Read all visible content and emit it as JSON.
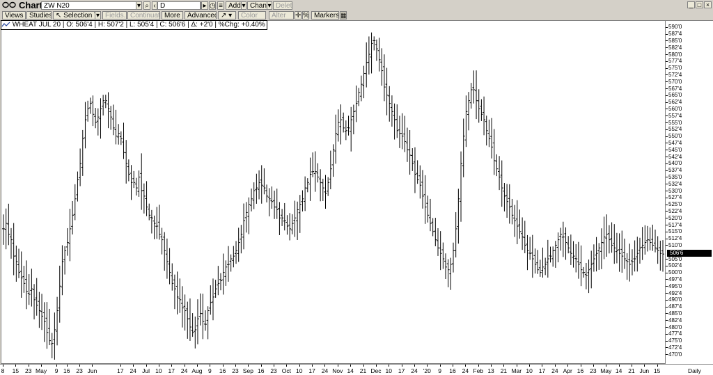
{
  "window": {
    "title": "Chart"
  },
  "header": {
    "symbol": "ZW N20",
    "interval": "D",
    "add_label": "Add",
    "change_label": "Change",
    "delete_label": "Delete"
  },
  "toolbar": {
    "views": "Views",
    "studies": "Studies...",
    "selection_tool": "Selection Tool",
    "fields": "Fields...",
    "continuation": "Continuation",
    "more": "More",
    "advanced": "Advanced",
    "color": "Color",
    "alter": "Alter",
    "percent": "%",
    "markers": "Markers"
  },
  "legend": {
    "name": "WHEAT JUL 20",
    "open": "O: 506'4",
    "high": "H: 507'2",
    "low": "L: 505'4",
    "close": "C: 506'6",
    "change": "Δ: +2'0",
    "pct_change": "%Chg: +0.40%"
  },
  "chart_data": {
    "type": "ohlc",
    "series_name": "WHEAT JUL 20",
    "last_price": "506'6",
    "last_value": 506.75,
    "y_range": [
      467,
      592
    ],
    "y_tick_labels": [
      "590'0",
      "587'4",
      "585'0",
      "582'4",
      "580'0",
      "577'4",
      "575'0",
      "572'4",
      "570'0",
      "567'4",
      "565'0",
      "562'4",
      "560'0",
      "557'4",
      "555'0",
      "552'4",
      "550'0",
      "547'4",
      "545'0",
      "542'4",
      "540'0",
      "537'4",
      "535'0",
      "532'4",
      "530'0",
      "527'4",
      "525'0",
      "522'4",
      "520'0",
      "517'4",
      "515'0",
      "512'4",
      "510'0",
      "505'0",
      "502'4",
      "500'0",
      "497'4",
      "495'0",
      "492'4",
      "490'0",
      "487'4",
      "485'0",
      "482'4",
      "480'0",
      "477'4",
      "475'0",
      "472'4",
      "470'0"
    ],
    "y_tick_values": [
      590,
      587.5,
      585,
      582.5,
      580,
      577.5,
      575,
      572.5,
      570,
      567.5,
      565,
      562.5,
      560,
      557.5,
      555,
      552.5,
      550,
      547.5,
      545,
      542.5,
      540,
      537.5,
      535,
      532.5,
      530,
      527.5,
      525,
      522.5,
      520,
      517.5,
      515,
      512.5,
      510,
      505,
      502.5,
      500,
      497.5,
      495,
      492.5,
      490,
      487.5,
      485,
      482.5,
      480,
      477.5,
      475,
      472.5,
      470
    ],
    "x_tick_labels": [
      "8",
      "15",
      "23",
      "May",
      "9",
      "16",
      "23",
      "Jun",
      "17",
      "24",
      "Jul",
      "10",
      "17",
      "24",
      "Aug",
      "9",
      "16",
      "23",
      "Sep",
      "16",
      "23",
      "Oct",
      "10",
      "17",
      "24",
      "Nov",
      "14",
      "21",
      "Dec",
      "10",
      "17",
      "24",
      "'20",
      "9",
      "16",
      "24",
      "Feb",
      "13",
      "21",
      "Mar",
      "10",
      "17",
      "24",
      "Apr",
      "16",
      "23",
      "May",
      "14",
      "21",
      "Jun",
      "15"
    ],
    "x_tick_index": [
      0,
      5,
      10,
      15,
      21,
      25,
      30,
      35,
      46,
      51,
      56,
      61,
      66,
      71,
      76,
      81,
      86,
      91,
      96,
      101,
      106,
      111,
      116,
      121,
      126,
      131,
      136,
      141,
      146,
      151,
      156,
      161,
      166,
      171,
      176,
      181,
      186,
      191,
      196,
      201,
      206,
      211,
      216,
      221,
      226,
      231,
      236,
      241,
      246,
      251,
      256
    ],
    "x_axis_period": "Daily",
    "closes": [
      516,
      518,
      514,
      512,
      506,
      504,
      500,
      498,
      496,
      493,
      492,
      494,
      490,
      488,
      486,
      484,
      482,
      478,
      475,
      474,
      479,
      486,
      495,
      504,
      508,
      511,
      516,
      521,
      527,
      534,
      540,
      549,
      556,
      560,
      562,
      558,
      555,
      557,
      560,
      563,
      563,
      560,
      557,
      553,
      550,
      551,
      549,
      544,
      540,
      536,
      533,
      533,
      531,
      535,
      530,
      528,
      524,
      521,
      520,
      518,
      517,
      514,
      512,
      508,
      504,
      500,
      496,
      494,
      491,
      490,
      487,
      486,
      483,
      480,
      478,
      479,
      483,
      485,
      482,
      481,
      486,
      489,
      491,
      494,
      496,
      497,
      500,
      502,
      503,
      505,
      506,
      508,
      511,
      514,
      519,
      522,
      525,
      527,
      530,
      531,
      533,
      532,
      531,
      528,
      527,
      526,
      524,
      523,
      520,
      520,
      519,
      517,
      516,
      518,
      520,
      523,
      525,
      527,
      531,
      533,
      536,
      537,
      537,
      535,
      533,
      531,
      529,
      533,
      538,
      545,
      551,
      555,
      556,
      553,
      552,
      553,
      556,
      559,
      562,
      566,
      569,
      573,
      577,
      580,
      584,
      585,
      582,
      578,
      574,
      568,
      565,
      562,
      559,
      556,
      552,
      551,
      550,
      548,
      545,
      543,
      540,
      536,
      534,
      532,
      528,
      524,
      521,
      518,
      515,
      512,
      509,
      507,
      505,
      502,
      501,
      503,
      508,
      516,
      527,
      540,
      550,
      559,
      563,
      567,
      567,
      563,
      560,
      558,
      556,
      552,
      549,
      546,
      541,
      538,
      535,
      531,
      528,
      526,
      524,
      521,
      519,
      517,
      515,
      513,
      510,
      508,
      507,
      505,
      503,
      501,
      500,
      502,
      503,
      505,
      506,
      508,
      510,
      512,
      514,
      513,
      511,
      509,
      507,
      506,
      505,
      503,
      501,
      500,
      499,
      501,
      503,
      505,
      507,
      509,
      511,
      513,
      514,
      512,
      510,
      509,
      508,
      507,
      506,
      505,
      504,
      503,
      504,
      505,
      507,
      509,
      510,
      511,
      512,
      511,
      510,
      509,
      508,
      507,
      506.75
    ]
  }
}
